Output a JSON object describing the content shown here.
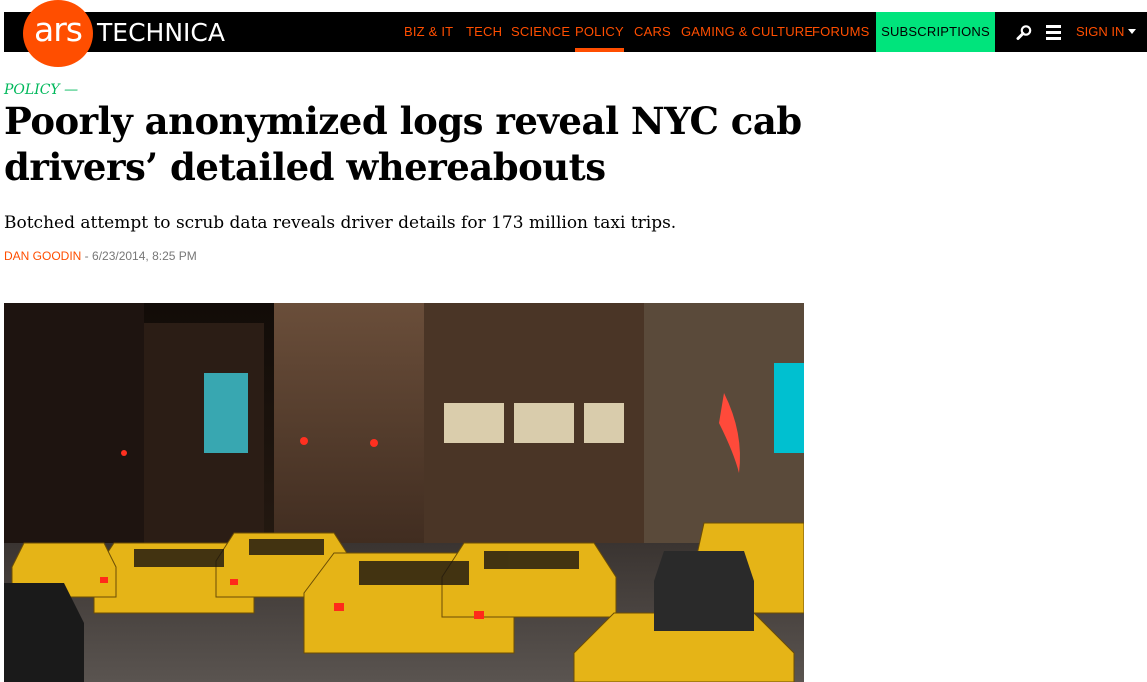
{
  "header": {
    "logo_ars": "ars",
    "logo_technica": "TECHNICA",
    "nav": [
      {
        "label": "BIZ & IT"
      },
      {
        "label": "TECH"
      },
      {
        "label": "SCIENCE"
      },
      {
        "label": "POLICY",
        "active": true
      },
      {
        "label": "CARS"
      },
      {
        "label": "GAMING & CULTURE"
      },
      {
        "label": "FORUMS"
      }
    ],
    "subscriptions_label": "SUBSCRIPTIONS",
    "sign_in_label": "SIGN IN",
    "icons": [
      "search-icon",
      "menu-icon",
      "chevron-down-icon"
    ]
  },
  "article": {
    "kicker": "POLICY —",
    "title": "Poorly anonymized logs reveal NYC cab drivers’ detailed whereabouts",
    "dek": "Botched attempt to scrub data reveals driver details for 173 million taxi trips.",
    "author": "DAN GOODIN",
    "separator": " - ",
    "date": "6/23/2014, 8:25 PM",
    "hero_image": "photo of yellow taxi cabs on a New York City street at night"
  },
  "colors": {
    "brand_orange": "#ff4e00",
    "subscriptions_green": "#00e47c",
    "kicker_green": "#00b85b",
    "topbar_black": "#000000"
  }
}
